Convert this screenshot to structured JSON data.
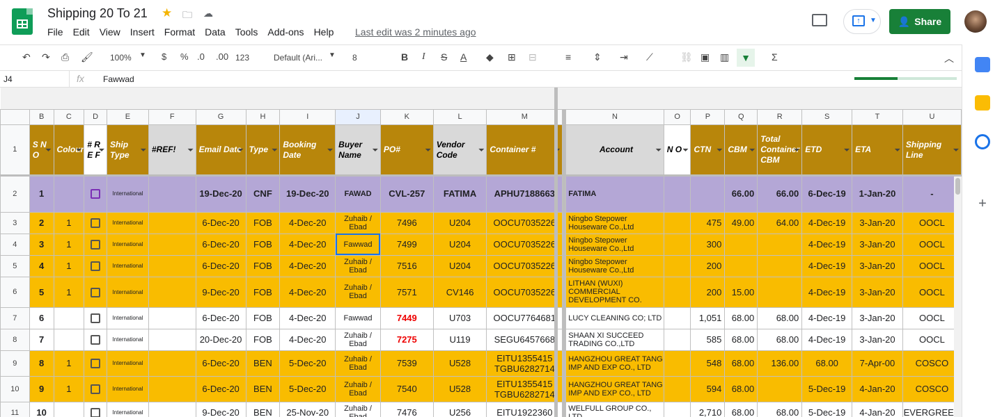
{
  "app": {
    "doc_title": "Shipping 20 To 21",
    "last_edit": "Last edit was 2 minutes ago",
    "share_label": "Share"
  },
  "menu": [
    "File",
    "Edit",
    "View",
    "Insert",
    "Format",
    "Data",
    "Tools",
    "Add-ons",
    "Help"
  ],
  "toolbar": {
    "zoom": "100%",
    "currency": "$",
    "percent": "%",
    "dec_less": ".0",
    "dec_more": ".00",
    "format_more": "123",
    "font": "Default (Ari...",
    "font_size": "8",
    "bold": "B",
    "italic": "I",
    "strike": "S",
    "text_color": "A",
    "sum": "Σ"
  },
  "formula_bar": {
    "cell_ref": "J4",
    "fx": "fx",
    "value": "Fawwad"
  },
  "loading_progress": 0.42,
  "columns": [
    "B",
    "C",
    "D",
    "E",
    "F",
    "G",
    "H",
    "I",
    "J",
    "K",
    "L",
    "M",
    "N",
    "O",
    "P",
    "Q",
    "R",
    "S",
    "T",
    "U"
  ],
  "header_row": [
    "S N O",
    "Colour",
    "# R E F",
    "Ship Type",
    "#REF!",
    "Email Date",
    "Type",
    "Booking Date",
    "Buyer Name",
    "PO#",
    "Vendor Code",
    "Container #",
    "Account",
    "N O",
    "CTN",
    "CBM",
    "Total Container CBM",
    "ETD",
    "ETA",
    "Shipping Line"
  ],
  "rows": [
    {
      "num": "2",
      "cells": [
        "1",
        "",
        "",
        "International",
        "",
        "19-Dec-20",
        "CNF",
        "19-Dec-20",
        "FAWAD",
        "CVL-257",
        "FATIMA",
        "APHU7188663",
        "FATIMA",
        "",
        "",
        "66.00",
        "66.00",
        "6-Dec-19",
        "1-Jan-20",
        "-"
      ]
    },
    {
      "num": "3",
      "cells": [
        "2",
        "1",
        "",
        "International",
        "",
        "6-Dec-20",
        "FOB",
        "4-Dec-20",
        "Zuhaib / Ebad",
        "7496",
        "U204",
        "OOCU7035226",
        "Ningbo Stepower Houseware Co.,Ltd",
        "",
        "475",
        "49.00",
        "64.00",
        "4-Dec-19",
        "3-Jan-20",
        "OOCL"
      ]
    },
    {
      "num": "4",
      "cells": [
        "3",
        "1",
        "",
        "International",
        "",
        "6-Dec-20",
        "FOB",
        "4-Dec-20",
        "Fawwad",
        "7499",
        "U204",
        "OOCU7035226",
        "Ningbo Stepower Houseware Co.,Ltd",
        "",
        "300",
        "",
        "",
        "4-Dec-19",
        "3-Jan-20",
        "OOCL"
      ]
    },
    {
      "num": "5",
      "cells": [
        "4",
        "1",
        "",
        "International",
        "",
        "6-Dec-20",
        "FOB",
        "4-Dec-20",
        "Zuhaib / Ebad",
        "7516",
        "U204",
        "OOCU7035226",
        "Ningbo Stepower Houseware Co.,Ltd",
        "",
        "200",
        "",
        "",
        "4-Dec-19",
        "3-Jan-20",
        "OOCL"
      ]
    },
    {
      "num": "6",
      "cells": [
        "5",
        "1",
        "",
        "International",
        "",
        "9-Dec-20",
        "FOB",
        "4-Dec-20",
        "Zuhaib / Ebad",
        "7571",
        "CV146",
        "OOCU7035226",
        "LITHAN (WUXI) COMMERCIAL DEVELOPMENT CO.",
        "",
        "200",
        "15.00",
        "",
        "4-Dec-19",
        "3-Jan-20",
        "OOCL"
      ]
    },
    {
      "num": "7",
      "cells": [
        "6",
        "",
        "",
        "International",
        "",
        "6-Dec-20",
        "FOB",
        "4-Dec-20",
        "Fawwad",
        "7449",
        "U703",
        "OOCU7764681",
        "LUCY CLEANING CO; LTD",
        "",
        "1,051",
        "68.00",
        "68.00",
        "4-Dec-19",
        "3-Jan-20",
        "OOCL"
      ]
    },
    {
      "num": "8",
      "cells": [
        "7",
        "",
        "",
        "International",
        "",
        "20-Dec-20",
        "FOB",
        "4-Dec-20",
        "Zuhaib / Ebad",
        "7275",
        "U119",
        "SEGU6457668",
        "SHAAN XI SUCCEED TRADING CO.,LTD",
        "",
        "585",
        "68.00",
        "68.00",
        "4-Dec-19",
        "3-Jan-20",
        "OOCL"
      ]
    },
    {
      "num": "9",
      "cells": [
        "8",
        "1",
        "",
        "International",
        "",
        "6-Dec-20",
        "BEN",
        "5-Dec-20",
        "Zuhaib / Ebad",
        "7539",
        "U528",
        "EITU1355415 TGBU6282714",
        "HANGZHOU GREAT TANG IMP AND EXP CO., LTD",
        "",
        "548",
        "68.00",
        "136.00",
        "68.00",
        "7-Apr-00",
        "COSCO"
      ]
    },
    {
      "num": "10",
      "cells": [
        "9",
        "1",
        "",
        "International",
        "",
        "6-Dec-20",
        "BEN",
        "5-Dec-20",
        "Zuhaib / Ebad",
        "7540",
        "U528",
        "EITU1355415 TGBU6282714",
        "HANGZHOU GREAT TANG IMP AND EXP CO., LTD",
        "",
        "594",
        "68.00",
        "",
        "5-Dec-19",
        "4-Jan-20",
        "COSCO"
      ]
    },
    {
      "num": "11",
      "cells": [
        "10",
        "",
        "",
        "International",
        "",
        "9-Dec-20",
        "BEN",
        "25-Nov-20",
        "Zuhaib / Ebad",
        "7476",
        "U256",
        "EITU1922360",
        "WELFULL GROUP CO., LTD",
        "",
        "2,710",
        "68.00",
        "68.00",
        "5-Dec-19",
        "4-Jan-20",
        "EVERGREEN"
      ]
    }
  ],
  "row_styles": [
    "purple",
    "gold",
    "gold",
    "gold",
    "gold",
    "white",
    "white",
    "gold",
    "gold",
    "white"
  ],
  "red_po_rows": [
    5,
    6
  ],
  "colors": {
    "header_gold": "#b8860b",
    "row_gold": "#f9bc00",
    "row_purple": "#b4a7d6",
    "share_green": "#188038"
  }
}
